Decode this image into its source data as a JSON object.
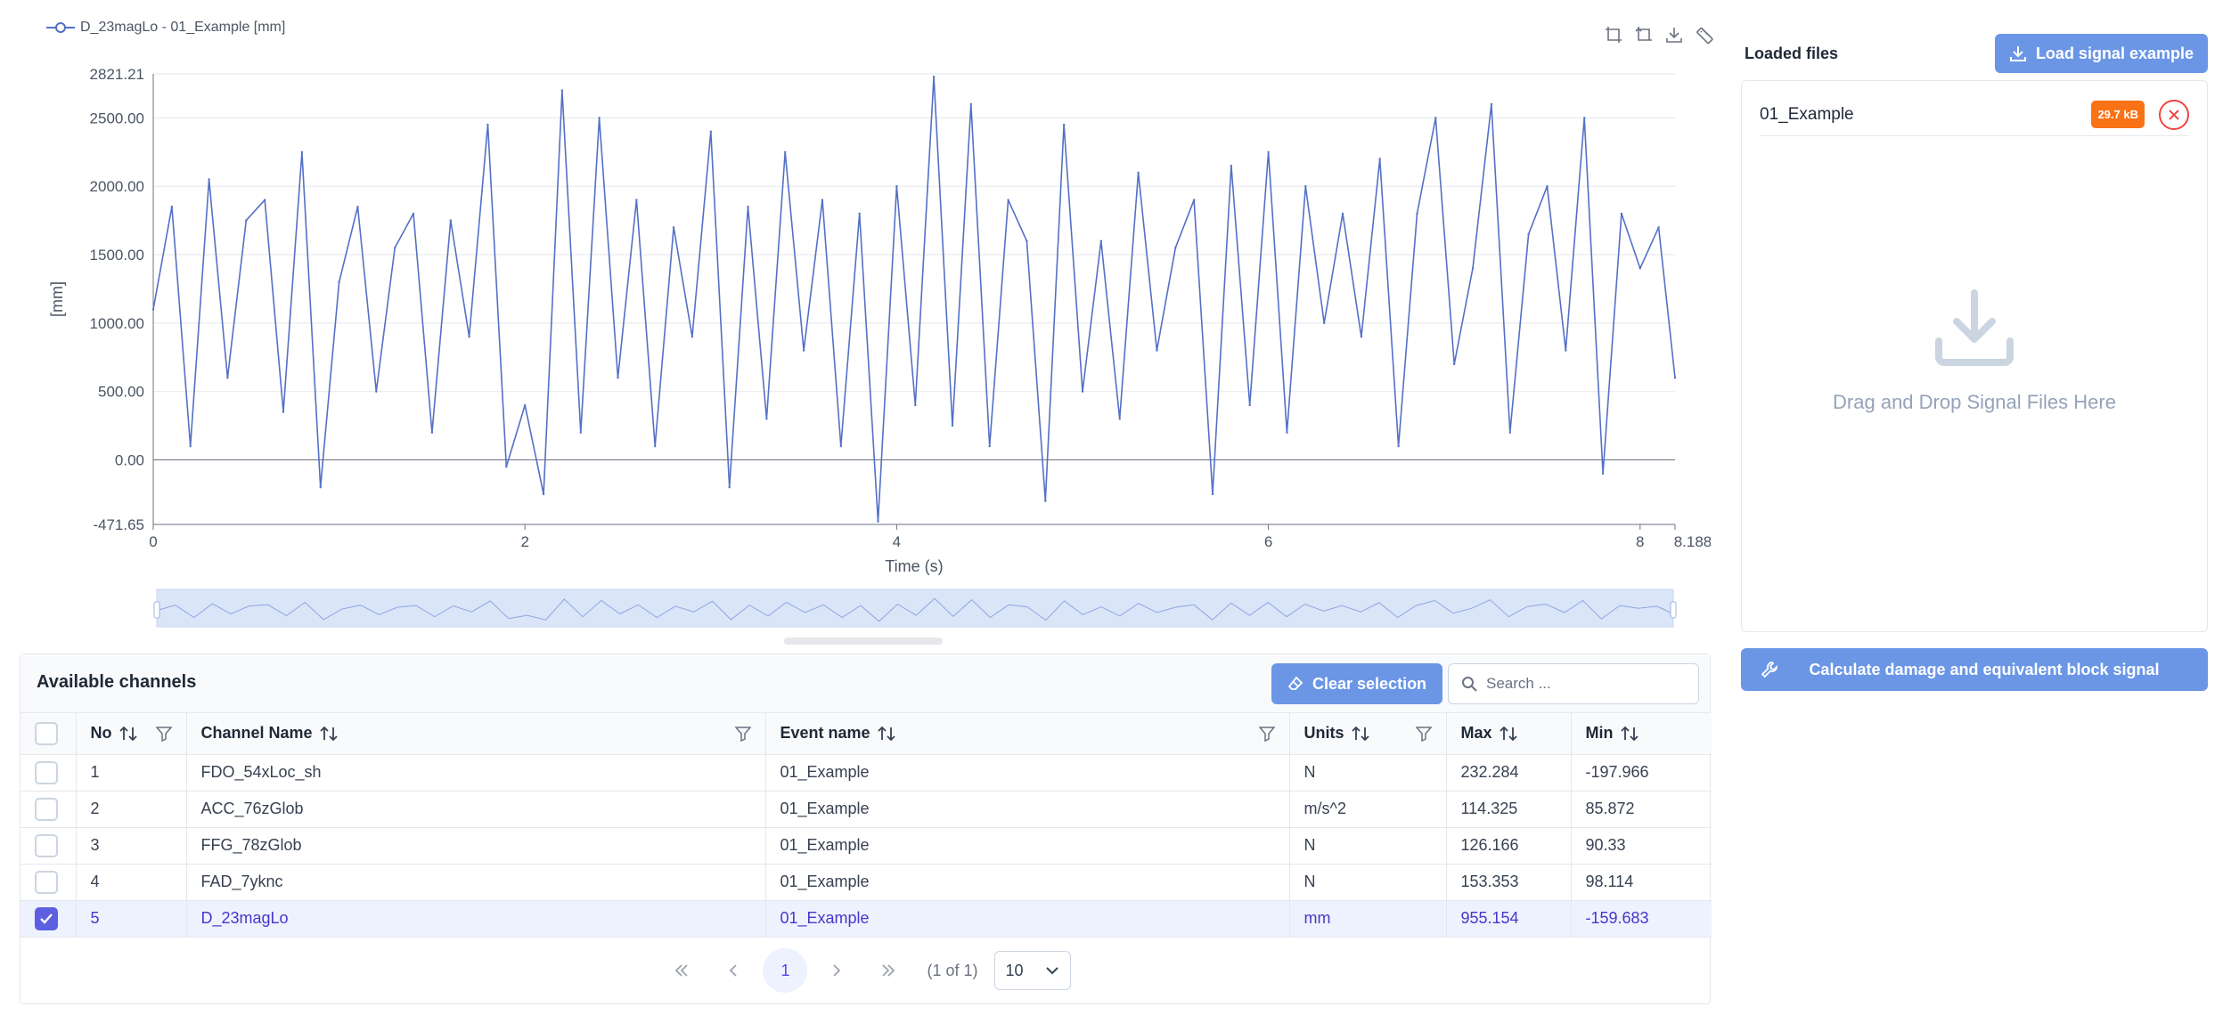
{
  "chart": {
    "legend_label": "D_23magLo - 01_Example [mm]",
    "toolbox_icons": [
      "zoom-select-icon",
      "zoom-reset-icon",
      "download-icon",
      "ruler-icon"
    ],
    "line_color": "#5470c6"
  },
  "chart_data": {
    "type": "line",
    "title": "",
    "series": [
      {
        "name": "D_23magLo - 01_Example [mm]",
        "x": [
          0,
          0.1,
          0.2,
          0.3,
          0.4,
          0.5,
          0.6,
          0.7,
          0.8,
          0.9,
          1.0,
          1.1,
          1.2,
          1.3,
          1.4,
          1.5,
          1.6,
          1.7,
          1.8,
          1.9,
          2.0,
          2.1,
          2.2,
          2.3,
          2.4,
          2.5,
          2.6,
          2.7,
          2.8,
          2.9,
          3.0,
          3.1,
          3.2,
          3.3,
          3.4,
          3.5,
          3.6,
          3.7,
          3.8,
          3.9,
          4.0,
          4.1,
          4.2,
          4.3,
          4.4,
          4.5,
          4.6,
          4.7,
          4.8,
          4.9,
          5.0,
          5.1,
          5.2,
          5.3,
          5.4,
          5.5,
          5.6,
          5.7,
          5.8,
          5.9,
          6.0,
          6.1,
          6.2,
          6.3,
          6.4,
          6.5,
          6.6,
          6.7,
          6.8,
          6.9,
          7.0,
          7.1,
          7.2,
          7.3,
          7.4,
          7.5,
          7.6,
          7.7,
          7.8,
          7.9,
          8.0,
          8.1,
          8.188
        ],
        "values": [
          1100,
          1850,
          100,
          2050,
          600,
          1750,
          1900,
          350,
          2250,
          -200,
          1300,
          1850,
          500,
          1550,
          1800,
          200,
          1750,
          900,
          2450,
          -50,
          400,
          -250,
          2700,
          200,
          2500,
          600,
          1900,
          100,
          1700,
          900,
          2400,
          -200,
          1850,
          300,
          2250,
          800,
          1900,
          100,
          1800,
          -450,
          2000,
          400,
          2800,
          250,
          2600,
          100,
          1900,
          1600,
          -300,
          2450,
          500,
          1600,
          300,
          2100,
          800,
          1550,
          1900,
          -250,
          2150,
          400,
          2250,
          200,
          2000,
          1000,
          1800,
          900,
          2200,
          100,
          1800,
          2500,
          700,
          1400,
          2600,
          200,
          1650,
          2000,
          800,
          2500,
          -100,
          1800,
          1400,
          1700,
          600
        ]
      }
    ],
    "xlabel": "Time (s)",
    "ylabel": "[mm]",
    "xlim": [
      0,
      8.188
    ],
    "ylim": [
      -471.65,
      2821.21
    ],
    "x_ticks": [
      "0",
      "2",
      "4",
      "6",
      "8",
      "8.188"
    ],
    "x_tick_values": [
      0,
      2,
      4,
      6,
      8,
      8.188
    ],
    "y_ticks": [
      "2821.21",
      "2500.00",
      "2000.00",
      "1500.00",
      "1000.00",
      "500.00",
      "0.00",
      "-471.65"
    ],
    "y_tick_values": [
      2821.21,
      2500,
      2000,
      1500,
      1000,
      500,
      0,
      -471.65
    ],
    "grid": true,
    "legend_position": "top-left"
  },
  "files": {
    "title": "Loaded files",
    "load_button": "Load signal example",
    "items": [
      {
        "name": "01_Example",
        "size": "29.7 kB"
      }
    ],
    "drop_text": "Drag and Drop Signal Files Here",
    "calc_button": "Calculate damage and equivalent block signal",
    "accent_color": "#6b96e6",
    "badge_color": "#f97316"
  },
  "table": {
    "title": "Available channels",
    "clear_button": "Clear selection",
    "search_placeholder": "Search ...",
    "columns": [
      "No",
      "Channel Name",
      "Event name",
      "Units",
      "Max",
      "Min"
    ],
    "rows": [
      {
        "no": "1",
        "channel": "FDO_54xLoc_sh",
        "event": "01_Example",
        "units": "N",
        "max": "232.284",
        "min": "-197.966",
        "selected": false
      },
      {
        "no": "2",
        "channel": "ACC_76zGlob",
        "event": "01_Example",
        "units": "m/s^2",
        "max": "114.325",
        "min": "85.872",
        "selected": false
      },
      {
        "no": "3",
        "channel": "FFG_78zGlob",
        "event": "01_Example",
        "units": "N",
        "max": "126.166",
        "min": "90.33",
        "selected": false
      },
      {
        "no": "4",
        "channel": "FAD_7yknc",
        "event": "01_Example",
        "units": "N",
        "max": "153.353",
        "min": "98.114",
        "selected": false
      },
      {
        "no": "5",
        "channel": "D_23magLo",
        "event": "01_Example",
        "units": "mm",
        "max": "955.154",
        "min": "-159.683",
        "selected": true
      }
    ],
    "selected_color": "#5b5fe0"
  },
  "paginator": {
    "current_page": "1",
    "report": "(1 of 1)",
    "rows_per_page": "10"
  }
}
